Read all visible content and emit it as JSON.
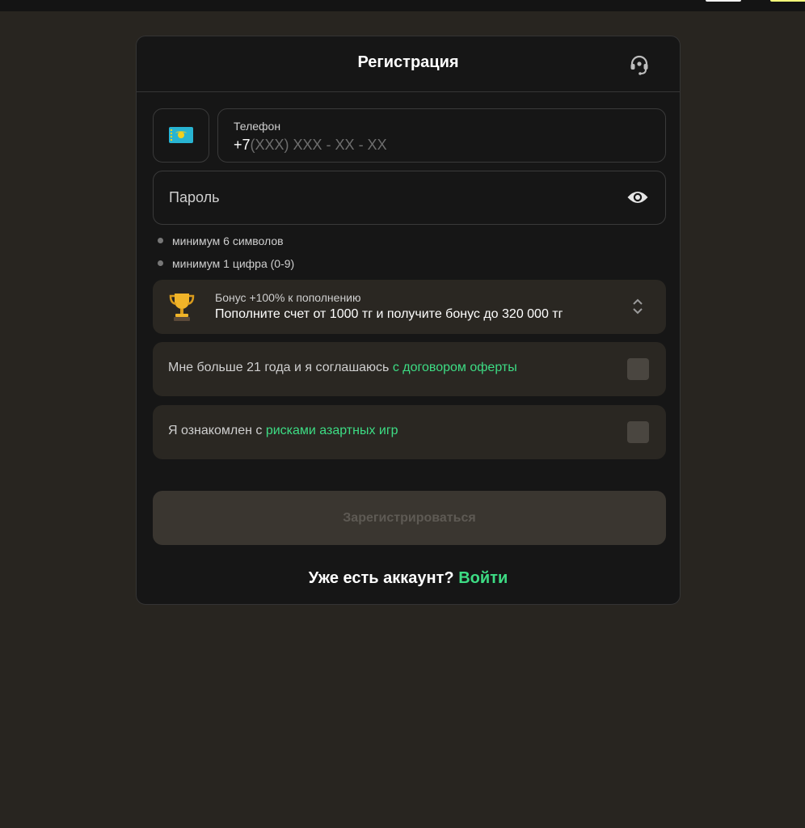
{
  "modal": {
    "title": "Регистрация",
    "support_icon": "headset-icon"
  },
  "phone": {
    "country_icon": "kazakhstan-flag-icon",
    "label": "Телефон",
    "prefix": "+7",
    "mask": "(XXX) XXX - XX - XX"
  },
  "password": {
    "placeholder": "Пароль",
    "toggle_icon": "eye-icon"
  },
  "rules": [
    "минимум 6 символов",
    "минимум 1 цифра (0-9)"
  ],
  "bonus": {
    "icon": "trophy-icon",
    "label": "Бонус +100% к пополнению",
    "text": "Пополните счет от 1000 тг и получите бонус до 320 000 тг",
    "expand_icon": "chevron-up-down-icon"
  },
  "agreements": {
    "age": {
      "text": "Мне больше 21 года и я соглашаюсь ",
      "link": "с договором оферты",
      "checked": false
    },
    "risks": {
      "text": "Я ознакомлен с ",
      "link": "рисками азартных игр",
      "checked": false
    }
  },
  "register_button": "Зарегистрироваться",
  "footer": {
    "text": "Уже есть аккаунт? ",
    "link": "Войти"
  },
  "colors": {
    "background": "#282520",
    "modal": "#161616",
    "card": "#2a2722",
    "accent": "#3ddc84",
    "disabled_button": "#3a3630"
  }
}
